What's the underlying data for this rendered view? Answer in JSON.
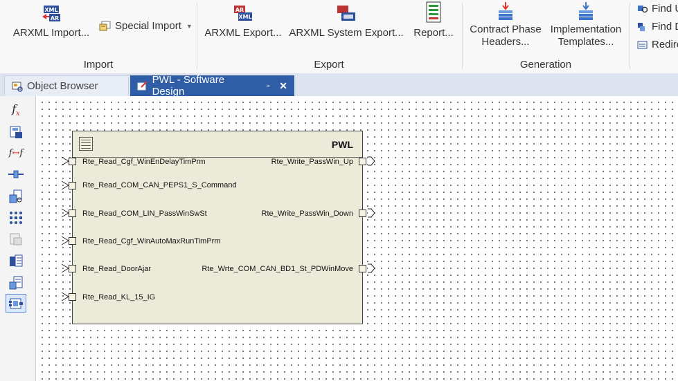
{
  "ribbon": {
    "groups": {
      "import": {
        "label": "Import",
        "arxml_import": "ARXML Import...",
        "special_import": "Special Import"
      },
      "export": {
        "label": "Export",
        "arxml_export": "ARXML Export...",
        "arxml_system_export": "ARXML System Export...",
        "report": "Report..."
      },
      "generation": {
        "label": "Generation",
        "contract_phase_line1": "Contract Phase",
        "contract_phase_line2": "Headers...",
        "implementation_line1": "Implementation",
        "implementation_line2": "Templates..."
      },
      "find": {
        "find_u": "Find U",
        "find_d": "Find D",
        "redire": "Redire"
      }
    },
    "icon_badges": {
      "xml": "XML",
      "arxml_short": "AR",
      "xml2": "XML",
      "ar2": "AR"
    }
  },
  "tabs": [
    {
      "label": "Object Browser",
      "active": false
    },
    {
      "label": "PWL - Software Design",
      "active": true
    }
  ],
  "tab_controls": {
    "pin": "▫",
    "close": "✕"
  },
  "toolbar_icons": [
    "function-icon",
    "save-component-icon",
    "function-mapping-icon",
    "connector-icon",
    "component-search-icon",
    "port-grid-icon",
    "disabled-component-icon",
    "table-view-icon",
    "data-view-icon",
    "component-layout-icon"
  ],
  "toolbar_labels": {
    "fx": "f",
    "fx_sub": "x",
    "fxfx": "f",
    "fxfx2": "f"
  },
  "component": {
    "name": "PWL",
    "in_ports": [
      "Rte_Read_Cgf_WinEnDelayTimPrm",
      "Rte_Read_COM_CAN_PEPS1_S_Command",
      "Rte_Read_COM_LIN_PassWinSwSt",
      "Rte_Read_Cgf_WinAutoMaxRunTimPrm",
      "Rte_Read_DoorAjar",
      "Rte_Read_KL_15_IG"
    ],
    "out_ports": [
      "Rte_Write_PassWin_Up",
      "Rte_Write_PassWin_Down",
      "Rte_Wrte_COM_CAN_BD1_St_PDWinMove"
    ]
  },
  "colors": {
    "tab_active": "#2f5ea6",
    "component_fill": "#ecebd9",
    "canvas_dot": "#555555"
  }
}
